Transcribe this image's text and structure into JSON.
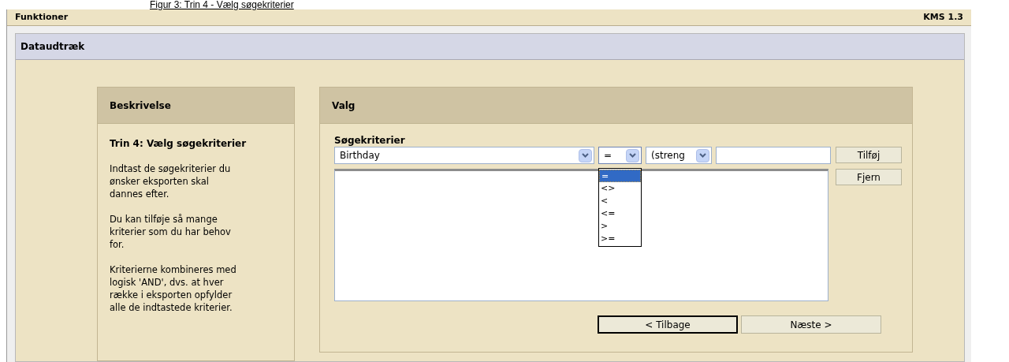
{
  "caption": "Figur 3: Trin 4 - Vælg søgekriterier",
  "header": {
    "title": "Funktioner",
    "version": "KMS 1.3"
  },
  "section": {
    "title": "Dataudtræk"
  },
  "description": {
    "title": "Beskrivelse",
    "heading": "Trin 4: Vælg søgekriterier",
    "paragraphs": [
      "Indtast de søgekriterier du ønsker eksporten skal dannes efter.",
      "Du kan tilføje så mange kriterier som du har behov for.",
      "Kriterierne kombineres med logisk 'AND', dvs. at hver række i eksporten opfylder alle de indtastede kriterier."
    ]
  },
  "selection": {
    "title": "Valg",
    "label": "Søgekriterier",
    "field_select": {
      "value": "Birthday"
    },
    "operator_select": {
      "value": "=",
      "expanded": true,
      "options": [
        {
          "label": "=",
          "selected": true
        },
        {
          "label": "<>",
          "selected": false
        },
        {
          "label": "<",
          "selected": false
        },
        {
          "label": "<=",
          "selected": false
        },
        {
          "label": ">",
          "selected": false
        },
        {
          "label": ">=",
          "selected": false
        }
      ]
    },
    "type_select": {
      "value": "(streng"
    },
    "add_button": "Tilføj",
    "remove_button": "Fjern",
    "nav_buttons": [
      {
        "label": "< Tilbage",
        "focused": true
      },
      {
        "label": "Næste >",
        "focused": false
      }
    ]
  }
}
